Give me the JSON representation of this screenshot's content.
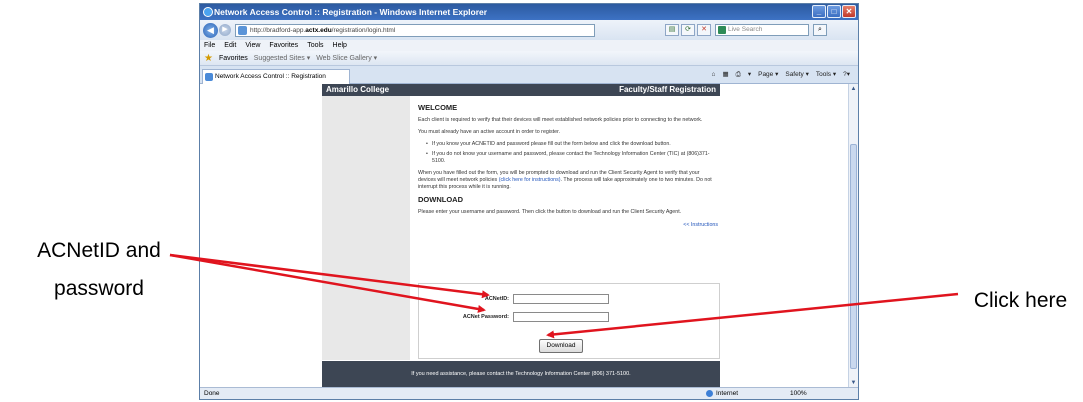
{
  "browser": {
    "window_title": "Network Access Control :: Registration - Windows Internet Explorer",
    "address": {
      "prefix": "http://bradford-app.",
      "domain": "actx.edu",
      "suffix": "/registration/login.html"
    },
    "search_placeholder": "Live Search",
    "menu": [
      "File",
      "Edit",
      "View",
      "Favorites",
      "Tools",
      "Help"
    ],
    "favorites_bar": {
      "favorites_label": "Favorites",
      "suggested_sites": "Suggested Sites ▾",
      "web_slice": "Web Slice Gallery ▾"
    },
    "tab_label": "Network Access Control :: Registration",
    "command_bar": [
      "▾",
      "Page ▾",
      "Safety ▾",
      "Tools ▾",
      "?▾"
    ],
    "status": {
      "left": "Done",
      "zone": "Internet",
      "zoom": "100%"
    }
  },
  "page": {
    "header_left": "Amarillo College",
    "header_right": "Faculty/Staff Registration",
    "welcome_heading": "WELCOME",
    "welcome_p1": "Each client is required to verify that their devices will meet established network policies prior to connecting to the network.",
    "welcome_p2": "You must already have an active account in order to register.",
    "bullet1": "If you know your ACNETID and password please fill out the form below and click the download button.",
    "bullet2": "If you do not know your username and password, please contact the Technology Information Center (TIC) at (806)371-5100.",
    "welcome_p3_a": "When you have filled out the form, you will be prompted to download and run the Client Security Agent to verify that your devices will meet network policies",
    "welcome_p3_link": "(click here for instructions)",
    "welcome_p3_b": ". The process will take approximately one to two minutes. Do not interrupt this process while it is running.",
    "download_heading": "DOWNLOAD",
    "download_p": "Please enter your username and password. Then click the button to download and run the Client Security Agent.",
    "instructions_link": "<< Instructions",
    "acnetid_label": "ACNetID:",
    "password_label": "ACNet Password:",
    "download_button": "Download",
    "footer": "If you need assistance, please contact the Technology Information Center (806) 371-5100."
  },
  "annotations": {
    "left_line1": "ACNetID and",
    "left_line2": "password",
    "right": "Click here",
    "arrow_color": "#e0141e"
  }
}
